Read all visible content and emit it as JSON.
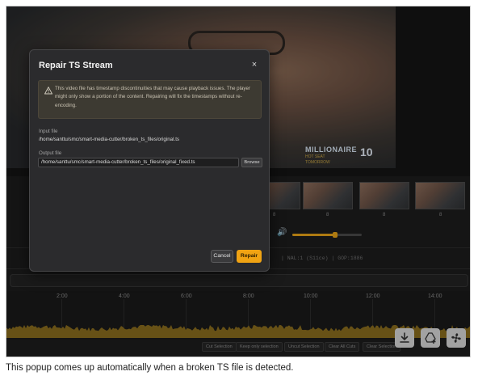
{
  "video": {
    "overlay_logo_line1": "MILLIONAIRE",
    "overlay_logo_line2": "HOT SEAT",
    "overlay_logo_line3": "TOMORROW",
    "overlay_badge": "10"
  },
  "thumbnails": {
    "labels": [
      "8",
      "8",
      "8",
      "8"
    ]
  },
  "volume": {
    "level": 0.62
  },
  "stream_info": "| NAL:1 (S11ce) | GOP:1886",
  "timeline": {
    "ticks": [
      "2:00",
      "4:00",
      "6:00",
      "8:00",
      "10:00",
      "12:00",
      "14:00"
    ]
  },
  "toolbar": {
    "buttons": [
      "Cut Selection",
      "Keep only selection",
      "Uncut Selection",
      "Clear All Cuts",
      "Clear Selection"
    ]
  },
  "fab_icons": [
    "download-icon",
    "add-drive-icon",
    "fan-icon"
  ],
  "modal": {
    "title": "Repair TS Stream",
    "close_label": "×",
    "warning": "This video file has timestamp discontinuities that may cause playback issues. The player might only show a portion of the content. Repairing will fix the timestamps without re-encoding.",
    "input_label": "Input file",
    "input_path": "/home/santtu/smc/smart-media-cutter/broken_ts_files/original.ts",
    "output_label": "Output file",
    "output_path": "/home/santtu/smc/smart-media-cutter/broken_ts_files/original_fixed.ts",
    "browse_label": "Browse",
    "cancel_label": "Cancel",
    "repair_label": "Repair"
  },
  "caption": "This popup comes up automatically when a broken TS file is detected.",
  "colors": {
    "accent": "#f0a313",
    "background": "#1c1c1d",
    "modal": "#2b2b2d"
  }
}
